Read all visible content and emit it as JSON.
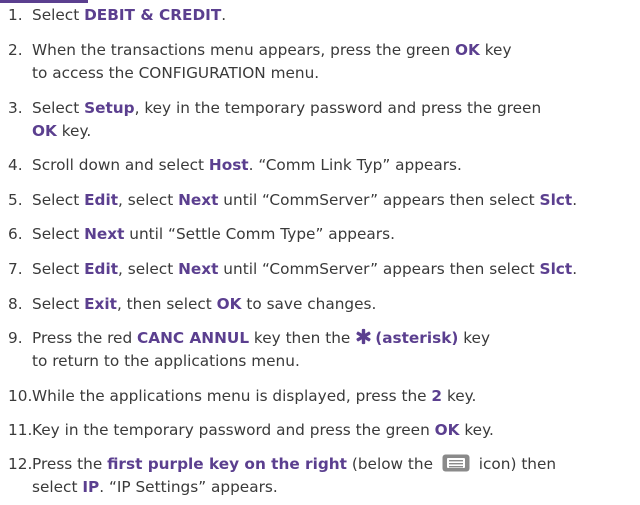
{
  "steps": [
    {
      "num": "1.",
      "parts": [
        {
          "t": "Select "
        },
        {
          "t": "DEBIT & CREDIT",
          "b": true
        },
        {
          "t": "."
        }
      ]
    },
    {
      "num": "2.",
      "parts": [
        {
          "t": "When the transactions menu appears, press the green "
        },
        {
          "t": "OK",
          "b": true
        },
        {
          "t": " key"
        },
        {
          "br": true
        },
        {
          "t": "to access the CONFIGURATION menu."
        }
      ]
    },
    {
      "num": "3.",
      "parts": [
        {
          "t": "Select "
        },
        {
          "t": "Setup",
          "b": true
        },
        {
          "t": ", key in the temporary password and press the green"
        },
        {
          "br": true
        },
        {
          "t": "OK",
          "b": true
        },
        {
          "t": " key."
        }
      ]
    },
    {
      "num": "4.",
      "parts": [
        {
          "t": "Scroll down and select "
        },
        {
          "t": "Host",
          "b": true
        },
        {
          "t": ". “Comm Link Typ” appears."
        }
      ]
    },
    {
      "num": "5.",
      "parts": [
        {
          "t": "Select "
        },
        {
          "t": "Edit",
          "b": true
        },
        {
          "t": ", select "
        },
        {
          "t": "Next",
          "b": true
        },
        {
          "t": " until “CommServer” appears then select "
        },
        {
          "t": "Slct",
          "b": true
        },
        {
          "t": "."
        }
      ]
    },
    {
      "num": "6.",
      "parts": [
        {
          "t": "Select "
        },
        {
          "t": "Next",
          "b": true
        },
        {
          "t": " until “Settle Comm Type” appears."
        }
      ]
    },
    {
      "num": "7.",
      "parts": [
        {
          "t": "Select "
        },
        {
          "t": "Edit",
          "b": true
        },
        {
          "t": ", select "
        },
        {
          "t": "Next",
          "b": true
        },
        {
          "t": " until “CommServer” appears then select "
        },
        {
          "t": "Slct",
          "b": true
        },
        {
          "t": "."
        }
      ]
    },
    {
      "num": "8.",
      "parts": [
        {
          "t": "Select "
        },
        {
          "t": "Exit",
          "b": true
        },
        {
          "t": ", then select "
        },
        {
          "t": "OK",
          "b": true
        },
        {
          "t": " to save changes."
        }
      ]
    },
    {
      "num": "9.",
      "parts": [
        {
          "t": "Press the red "
        },
        {
          "t": "CANC ANNUL",
          "b": true
        },
        {
          "t": " key then the "
        },
        {
          "icon": "asterisk-icon"
        },
        {
          "t": "(asterisk)",
          "b": true
        },
        {
          "t": " key"
        },
        {
          "br": true
        },
        {
          "t": "to return to the applications menu."
        }
      ]
    },
    {
      "num": "10.",
      "parts": [
        {
          "t": "While the applications menu is displayed, press the "
        },
        {
          "t": "2",
          "b": true
        },
        {
          "t": " key."
        }
      ]
    },
    {
      "num": "11.",
      "parts": [
        {
          "t": "Key in the temporary password and press the green "
        },
        {
          "t": "OK",
          "b": true
        },
        {
          "t": " key."
        }
      ]
    },
    {
      "num": "12.",
      "parts": [
        {
          "t": "Press the "
        },
        {
          "t": "first purple key on the right",
          "b": true
        },
        {
          "t": " (below the "
        },
        {
          "icon": "keypad-icon"
        },
        {
          "t": " icon) then"
        },
        {
          "br": true
        },
        {
          "t": "select "
        },
        {
          "t": "IP",
          "b": true
        },
        {
          "t": ". “IP Settings” appears."
        }
      ]
    }
  ],
  "colors": {
    "accent": "#5b3f8f",
    "text": "#3a3a3a",
    "background": "#ffffff"
  }
}
